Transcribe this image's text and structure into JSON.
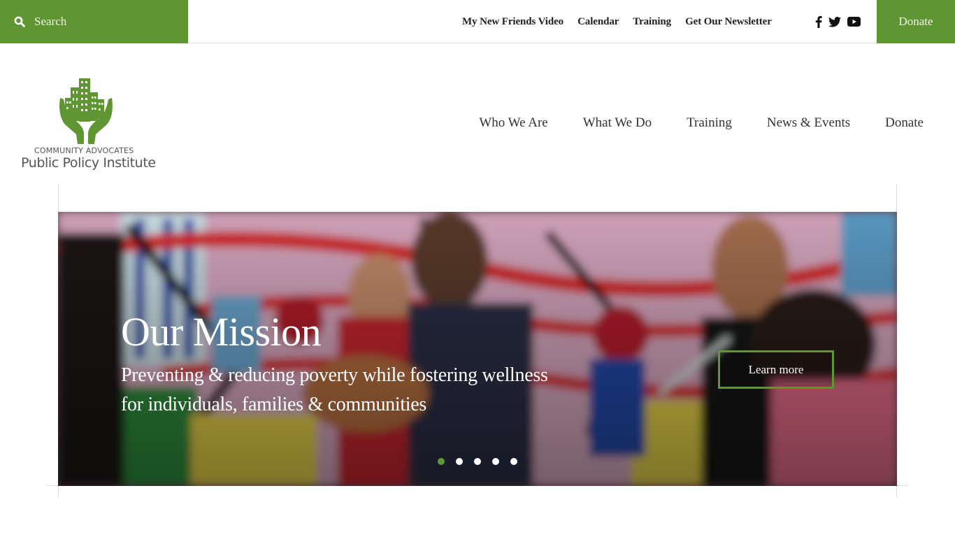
{
  "colors": {
    "brand_green": "#5e9732",
    "text_dark": "#222222"
  },
  "topbar": {
    "search_label": "Search",
    "search_icon": "search-icon",
    "links": [
      "My New Friends Video",
      "Calendar",
      "Training",
      "Get Our Newsletter"
    ],
    "social": [
      "facebook-icon",
      "twitter-icon",
      "youtube-icon"
    ],
    "donate_label": "Donate"
  },
  "logo": {
    "line1": "COMMUNITY ADVOCATES",
    "line2": "Public Policy Institute",
    "icon": "hands-holding-buildings-icon"
  },
  "mainnav": {
    "items": [
      "Who We Are",
      "What We Do",
      "Training",
      "News & Events",
      "Donate"
    ]
  },
  "hero": {
    "title": "Our Mission",
    "subtitle": "Preventing & reducing poverty while fostering wellness for individuals, families & communities",
    "cta_label": "Learn more",
    "slides_total": 5,
    "active_slide": 1
  }
}
